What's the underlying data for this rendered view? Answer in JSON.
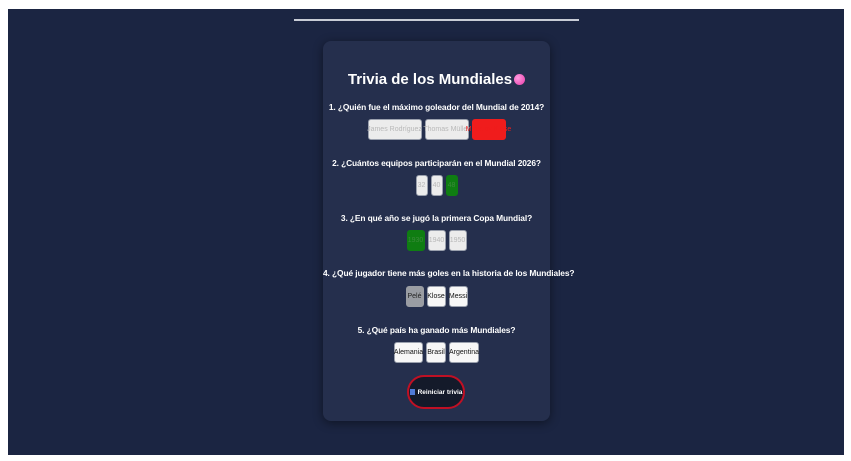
{
  "quiz": {
    "title": "Trivia de los Mundiales",
    "title_emoji": "pink-ball-icon",
    "questions": [
      {
        "text": "1. ¿Quién fue el máximo goleador del Mundial de 2014?",
        "options": [
          "James Rodríguez",
          "Thomas Müller",
          "Miroslav Klose"
        ]
      },
      {
        "text": "2. ¿Cuántos equipos participarán en el Mundial 2026?",
        "options": [
          "32",
          "40",
          "48"
        ]
      },
      {
        "text": "3. ¿En qué año se jugó la primera Copa Mundial?",
        "options": [
          "1930",
          "1940",
          "1950"
        ]
      },
      {
        "text": "4. ¿Qué jugador tiene más goles en la historia de los Mundiales?",
        "options": [
          "Pelé",
          "Klose",
          "Messi"
        ]
      },
      {
        "text": "5. ¿Qué país ha ganado más Mundiales?",
        "options": [
          "Alemania",
          "Brasil",
          "Argentina"
        ]
      }
    ],
    "restart_label": "Reiniciar trivia",
    "restart_icon": "reset-icon"
  },
  "colors": {
    "page_bg": "#1b2542",
    "card_bg": "#252f4d",
    "wrong": "#f01c1c",
    "correct": "#0f7d12",
    "selected": "#9a9da3",
    "restart_border": "#c01024"
  }
}
